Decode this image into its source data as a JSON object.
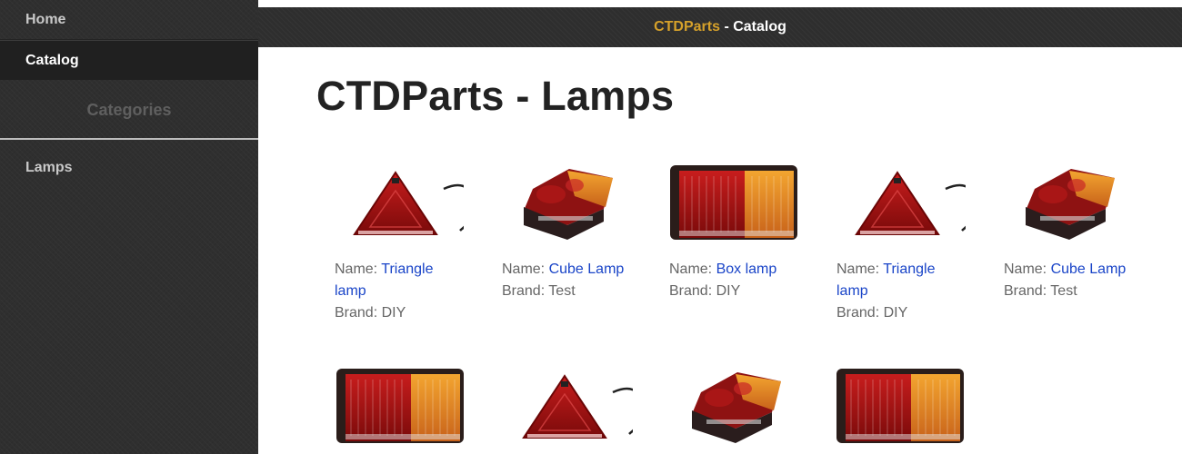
{
  "sidebar": {
    "home_label": "Home",
    "catalog_label": "Catalog",
    "categories_title": "Categories",
    "lamps_label": "Lamps"
  },
  "topbar": {
    "brand": "CTDParts",
    "rest": " - Catalog"
  },
  "page": {
    "title": "CTDParts - Lamps",
    "name_prefix": "Name: ",
    "brand_prefix": "Brand: "
  },
  "products": [
    {
      "name": "Triangle lamp",
      "brand": "DIY",
      "image": "triangle-lamp"
    },
    {
      "name": "Cube Lamp",
      "brand": "Test",
      "image": "cube-lamp"
    },
    {
      "name": "Box lamp",
      "brand": "DIY",
      "image": "box-lamp"
    },
    {
      "name": "Triangle lamp",
      "brand": "DIY",
      "image": "triangle-lamp"
    },
    {
      "name": "Cube Lamp",
      "brand": "Test",
      "image": "cube-lamp"
    },
    {
      "image": "box-lamp"
    },
    {
      "image": "triangle-lamp"
    },
    {
      "image": "cube-lamp"
    },
    {
      "image": "box-lamp"
    }
  ],
  "colors": {
    "sidebar_bg": "#2f2f2f",
    "brand_accent": "#d6a12a",
    "link": "#1a45c8"
  }
}
